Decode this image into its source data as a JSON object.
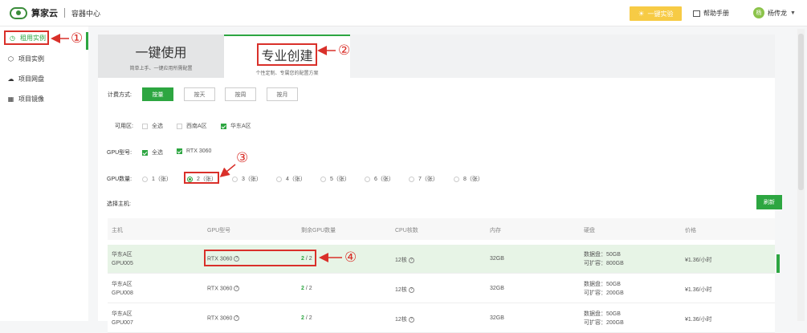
{
  "header": {
    "brand": "算家云",
    "subtitle": "容器中心",
    "quick_button": "一键实验",
    "help_label": "帮助手册",
    "user_avatar": "杨",
    "user_name": "杨传龙"
  },
  "sidebar": {
    "items": [
      {
        "label": "租用实例",
        "icon": "clock-icon"
      },
      {
        "label": "项目实例",
        "icon": "cube-icon"
      },
      {
        "label": "项目网盘",
        "icon": "cloud-icon"
      },
      {
        "label": "项目镜像",
        "icon": "grid-icon"
      }
    ]
  },
  "mode_tabs": [
    {
      "title": "一键使用",
      "subtitle": "简单上手、一键应用所需配置"
    },
    {
      "title": "专业创建",
      "subtitle": "个性定制、专属您的配置方案"
    }
  ],
  "billing": {
    "label": "计费方式:",
    "options": [
      "按量",
      "按天",
      "按周",
      "按月"
    ],
    "selected": "按量"
  },
  "region": {
    "label": "可用区:",
    "options": [
      {
        "label": "全选",
        "checked": false
      },
      {
        "label": "西南A区",
        "checked": false
      },
      {
        "label": "华东A区",
        "checked": true
      }
    ]
  },
  "gpu_model": {
    "label": "GPU型号:",
    "options": [
      {
        "label": "全选",
        "checked": true
      },
      {
        "label": "RTX 3060",
        "checked": true
      }
    ]
  },
  "gpu_count": {
    "label": "GPU数量:",
    "options": [
      "1（张）",
      "2（张）",
      "3（张）",
      "4（张）",
      "5（张）",
      "6（张）",
      "7（张）",
      "8（张）"
    ],
    "selected": "2（张）"
  },
  "host_select": {
    "label": "选择主机:",
    "refresh": "刷新"
  },
  "table": {
    "headers": [
      "主机",
      "GPU型号",
      "剩余GPU数量",
      "CPU核数",
      "内存",
      "硬盘",
      "价格"
    ],
    "rows": [
      {
        "host1": "华东A区",
        "host2": "GPU005",
        "gpu": "RTX 3060",
        "free": "2",
        "total": "/ 2",
        "cpu": "12核",
        "mem": "32GB",
        "disk1": "数据盘：50GB",
        "disk2": "可扩容：800GB",
        "price": "¥1.36/小时",
        "selected": true
      },
      {
        "host1": "华东A区",
        "host2": "GPU008",
        "gpu": "RTX 3060",
        "free": "2",
        "total": "/ 2",
        "cpu": "12核",
        "mem": "32GB",
        "disk1": "数据盘：50GB",
        "disk2": "可扩容：200GB",
        "price": "¥1.36/小时",
        "selected": false
      },
      {
        "host1": "华东A区",
        "host2": "GPU007",
        "gpu": "RTX 3060",
        "free": "2",
        "total": "/ 2",
        "cpu": "12核",
        "mem": "32GB",
        "disk1": "数据盘：50GB",
        "disk2": "可扩容：200GB",
        "price": "¥1.36/小时",
        "selected": false
      }
    ]
  },
  "annotations": {
    "markers": [
      "①",
      "②",
      "③",
      "④"
    ],
    "color": "#d9302a"
  },
  "colors": {
    "accent": "#2da641",
    "quick": "#f7cb45",
    "annotation": "#d9302a"
  }
}
